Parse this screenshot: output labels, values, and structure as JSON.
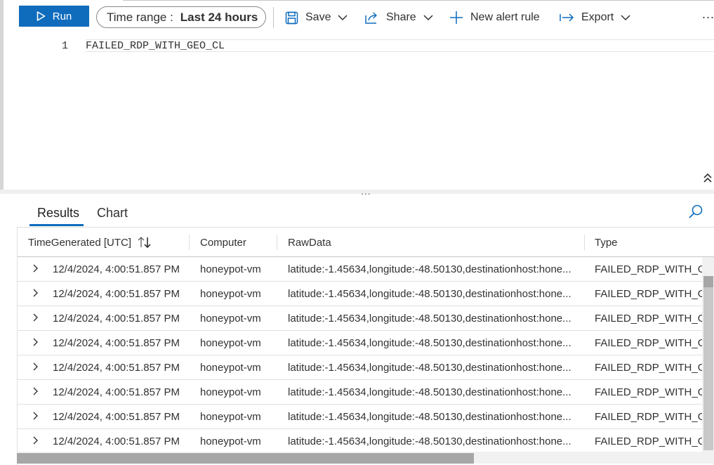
{
  "toolbar": {
    "run_label": "Run",
    "time_range_label": "Time range :",
    "time_range_value": "Last 24 hours",
    "save_label": "Save",
    "share_label": "Share",
    "new_alert_label": "New alert rule",
    "export_label": "Export",
    "more_label": "..."
  },
  "editor": {
    "line_number": "1",
    "query": "FAILED_RDP_WITH_GEO_CL"
  },
  "splitter": {
    "grip": "..."
  },
  "results": {
    "tabs": [
      {
        "label": "Results",
        "selected": true
      },
      {
        "label": "Chart",
        "selected": false
      }
    ],
    "columns": [
      "TimeGenerated [UTC]",
      "Computer",
      "RawData",
      "Type"
    ],
    "rows": [
      {
        "time": "12/4/2024, 4:00:51.857 PM",
        "computer": "honeypot-vm",
        "raw": "latitude:-1.45634,longitude:-48.50130,destinationhost:hone...",
        "type": "FAILED_RDP_WITH_GEC"
      },
      {
        "time": "12/4/2024, 4:00:51.857 PM",
        "computer": "honeypot-vm",
        "raw": "latitude:-1.45634,longitude:-48.50130,destinationhost:hone...",
        "type": "FAILED_RDP_WITH_GEC"
      },
      {
        "time": "12/4/2024, 4:00:51.857 PM",
        "computer": "honeypot-vm",
        "raw": "latitude:-1.45634,longitude:-48.50130,destinationhost:hone...",
        "type": "FAILED_RDP_WITH_GEC"
      },
      {
        "time": "12/4/2024, 4:00:51.857 PM",
        "computer": "honeypot-vm",
        "raw": "latitude:-1.45634,longitude:-48.50130,destinationhost:hone...",
        "type": "FAILED_RDP_WITH_GEC"
      },
      {
        "time": "12/4/2024, 4:00:51.857 PM",
        "computer": "honeypot-vm",
        "raw": "latitude:-1.45634,longitude:-48.50130,destinationhost:hone...",
        "type": "FAILED_RDP_WITH_GEC"
      },
      {
        "time": "12/4/2024, 4:00:51.857 PM",
        "computer": "honeypot-vm",
        "raw": "latitude:-1.45634,longitude:-48.50130,destinationhost:hone...",
        "type": "FAILED_RDP_WITH_GEC"
      },
      {
        "time": "12/4/2024, 4:00:51.857 PM",
        "computer": "honeypot-vm",
        "raw": "latitude:-1.45634,longitude:-48.50130,destinationhost:hone...",
        "type": "FAILED_RDP_WITH_GEC"
      },
      {
        "time": "12/4/2024, 4:00:51.857 PM",
        "computer": "honeypot-vm",
        "raw": "latitude:-1.45634,longitude:-48.50130,destinationhost:hone...",
        "type": "FAILED_RDP_WITH_GEC"
      }
    ]
  },
  "colors": {
    "accent": "#0f6cbd",
    "text": "#323130",
    "border": "#e1dfdd"
  },
  "icons": {
    "run": "play-icon",
    "save": "save-icon",
    "share": "share-icon",
    "new_alert": "plus-icon",
    "export": "export-arrow-icon",
    "search": "search-icon",
    "collapse": "double-chevron-up-icon",
    "expand_row": "chevron-right-icon",
    "sort": "sort-icon"
  }
}
